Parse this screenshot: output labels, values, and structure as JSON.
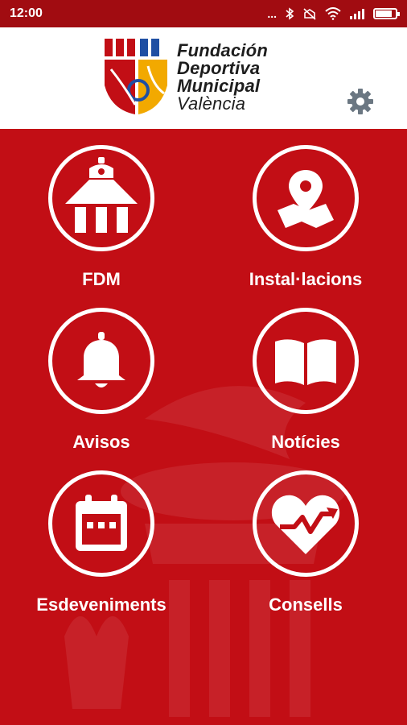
{
  "status": {
    "time": "12:00",
    "dots": "...",
    "battery_level": 0.9
  },
  "header": {
    "logo_lines": [
      "Fundación",
      "Deportiva",
      "Municipal",
      "València"
    ],
    "settings_icon": "gear-icon",
    "colors": {
      "brand_red": "#c20e15",
      "gold": "#f2a900",
      "blue": "#1f4fa3"
    }
  },
  "menu": [
    {
      "label": "FDM",
      "icon": "building-icon"
    },
    {
      "label": "Instal·lacions",
      "icon": "map-pin-icon"
    },
    {
      "label": "Avisos",
      "icon": "bell-icon"
    },
    {
      "label": "Notícies",
      "icon": "book-icon"
    },
    {
      "label": "Esdeveniments",
      "icon": "calendar-icon"
    },
    {
      "label": "Consells",
      "icon": "heart-rate-icon"
    }
  ]
}
